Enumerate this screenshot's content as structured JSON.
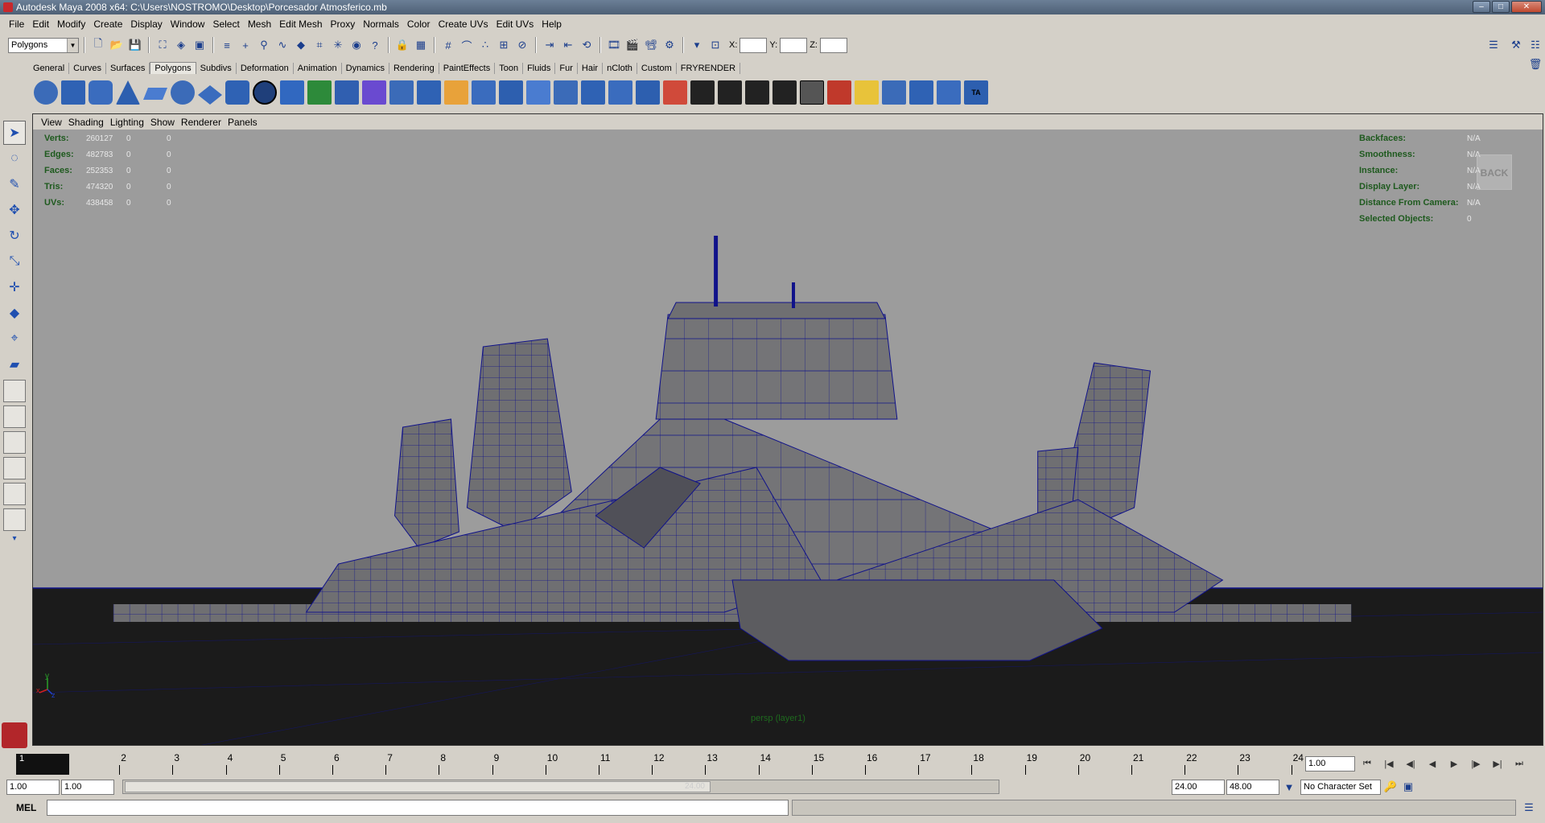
{
  "window": {
    "title": "Autodesk Maya 2008 x64: C:\\Users\\NOSTROMO\\Desktop\\Porcesador Atmosferico.mb"
  },
  "menu": [
    "File",
    "Edit",
    "Modify",
    "Create",
    "Display",
    "Window",
    "Select",
    "Mesh",
    "Edit Mesh",
    "Proxy",
    "Normals",
    "Color",
    "Create UVs",
    "Edit UVs",
    "Help"
  ],
  "status_line": {
    "mode": "Polygons",
    "x_label": "X:",
    "y_label": "Y:",
    "z_label": "Z:"
  },
  "shelf_tabs": [
    "General",
    "Curves",
    "Surfaces",
    "Polygons",
    "Subdivs",
    "Deformation",
    "Animation",
    "Dynamics",
    "Rendering",
    "PaintEffects",
    "Toon",
    "Fluids",
    "Fur",
    "Hair",
    "nCloth",
    "Custom",
    "FRYRENDER"
  ],
  "active_shelf_tab": "Polygons",
  "shelf_last_label": "TA",
  "panel_menu": [
    "View",
    "Shading",
    "Lighting",
    "Show",
    "Renderer",
    "Panels"
  ],
  "hud_stats": [
    {
      "label": "Verts:",
      "value": "260127",
      "sel": "0",
      "comp": "0"
    },
    {
      "label": "Edges:",
      "value": "482783",
      "sel": "0",
      "comp": "0"
    },
    {
      "label": "Faces:",
      "value": "252353",
      "sel": "0",
      "comp": "0"
    },
    {
      "label": "Tris:",
      "value": "474320",
      "sel": "0",
      "comp": "0"
    },
    {
      "label": "UVs:",
      "value": "438458",
      "sel": "0",
      "comp": "0"
    }
  ],
  "hud_right": [
    {
      "label": "Backfaces:",
      "value": "N/A"
    },
    {
      "label": "Smoothness:",
      "value": "N/A"
    },
    {
      "label": "Instance:",
      "value": "N/A"
    },
    {
      "label": "Display Layer:",
      "value": "N/A"
    },
    {
      "label": "Distance From Camera:",
      "value": "N/A"
    },
    {
      "label": "Selected Objects:",
      "value": "0"
    }
  ],
  "back_button": "BACK",
  "camera_label": "persp (layer1)",
  "axis_labels": {
    "y": "y",
    "x": "x",
    "z": "z"
  },
  "timeline": {
    "current_frame": "1",
    "ticks": [
      "2",
      "3",
      "4",
      "5",
      "6",
      "7",
      "8",
      "9",
      "10",
      "11",
      "12",
      "13",
      "14",
      "15",
      "16",
      "17",
      "18",
      "19",
      "20",
      "21",
      "22",
      "23",
      "24"
    ],
    "current_time": "1.00"
  },
  "range": {
    "start": "1.00",
    "playback_start": "1.00",
    "bar_label": "24.00",
    "playback_end": "24.00",
    "end": "48.00",
    "character_set": "No Character Set"
  },
  "command_line": {
    "label": "MEL"
  },
  "colors": {
    "wireframe": "#10128a",
    "viewport_bg": "#9c9c9c",
    "ground": "#1b1b1b"
  }
}
